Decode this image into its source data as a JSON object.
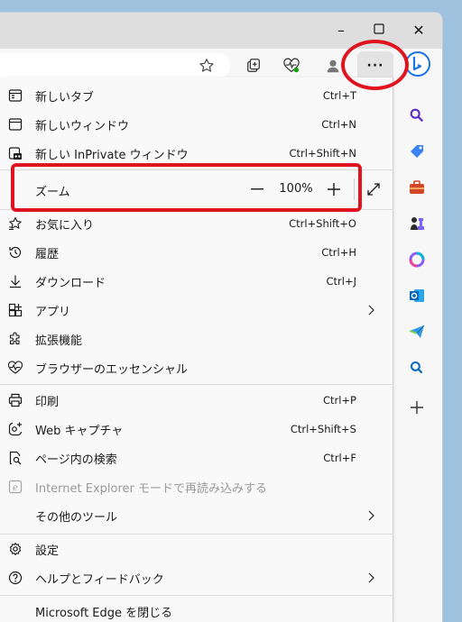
{
  "window": {
    "controls": [
      "–",
      "☐",
      "✕"
    ]
  },
  "menu": {
    "items_top": [
      {
        "label": "新しいタブ",
        "shortcut": "Ctrl+T",
        "icon": "new-tab-icon"
      },
      {
        "label": "新しいウィンドウ",
        "shortcut": "Ctrl+N",
        "icon": "new-window-icon"
      },
      {
        "label": "新しい InPrivate ウィンドウ",
        "shortcut": "Ctrl+Shift+N",
        "icon": "inprivate-icon"
      }
    ],
    "zoom": {
      "label": "ズーム",
      "value": "100%",
      "minus": "—",
      "plus": "+"
    },
    "items_mid": [
      {
        "label": "お気に入り",
        "shortcut": "Ctrl+Shift+O",
        "icon": "favorites-icon"
      },
      {
        "label": "履歴",
        "shortcut": "Ctrl+H",
        "icon": "history-icon"
      },
      {
        "label": "ダウンロード",
        "shortcut": "Ctrl+J",
        "icon": "download-icon"
      },
      {
        "label": "アプリ",
        "shortcut": "",
        "icon": "apps-icon",
        "submenu": true
      },
      {
        "label": "拡張機能",
        "shortcut": "",
        "icon": "extensions-icon"
      },
      {
        "label": "ブラウザーのエッセンシャル",
        "shortcut": "",
        "icon": "essentials-icon"
      }
    ],
    "items_tools": [
      {
        "label": "印刷",
        "shortcut": "Ctrl+P",
        "icon": "print-icon"
      },
      {
        "label": "Web キャプチャ",
        "shortcut": "Ctrl+Shift+S",
        "icon": "web-capture-icon"
      },
      {
        "label": "ページ内の検索",
        "shortcut": "Ctrl+F",
        "icon": "find-icon"
      },
      {
        "label": "Internet Explorer モードで再読み込みする",
        "shortcut": "",
        "icon": "ie-mode-icon",
        "disabled": true
      },
      {
        "label": "その他のツール",
        "shortcut": "",
        "icon": "",
        "submenu": true
      }
    ],
    "items_bottom": [
      {
        "label": "設定",
        "shortcut": "",
        "icon": "settings-icon"
      },
      {
        "label": "ヘルプとフィードバック",
        "shortcut": "",
        "icon": "help-icon",
        "submenu": true
      },
      {
        "label": "Microsoft Edge を閉じる",
        "shortcut": "",
        "icon": ""
      }
    ]
  },
  "toolbar": {
    "more_label": "···"
  },
  "colors": {
    "highlight": "#e0141e",
    "accent": "#0f6cbd"
  }
}
